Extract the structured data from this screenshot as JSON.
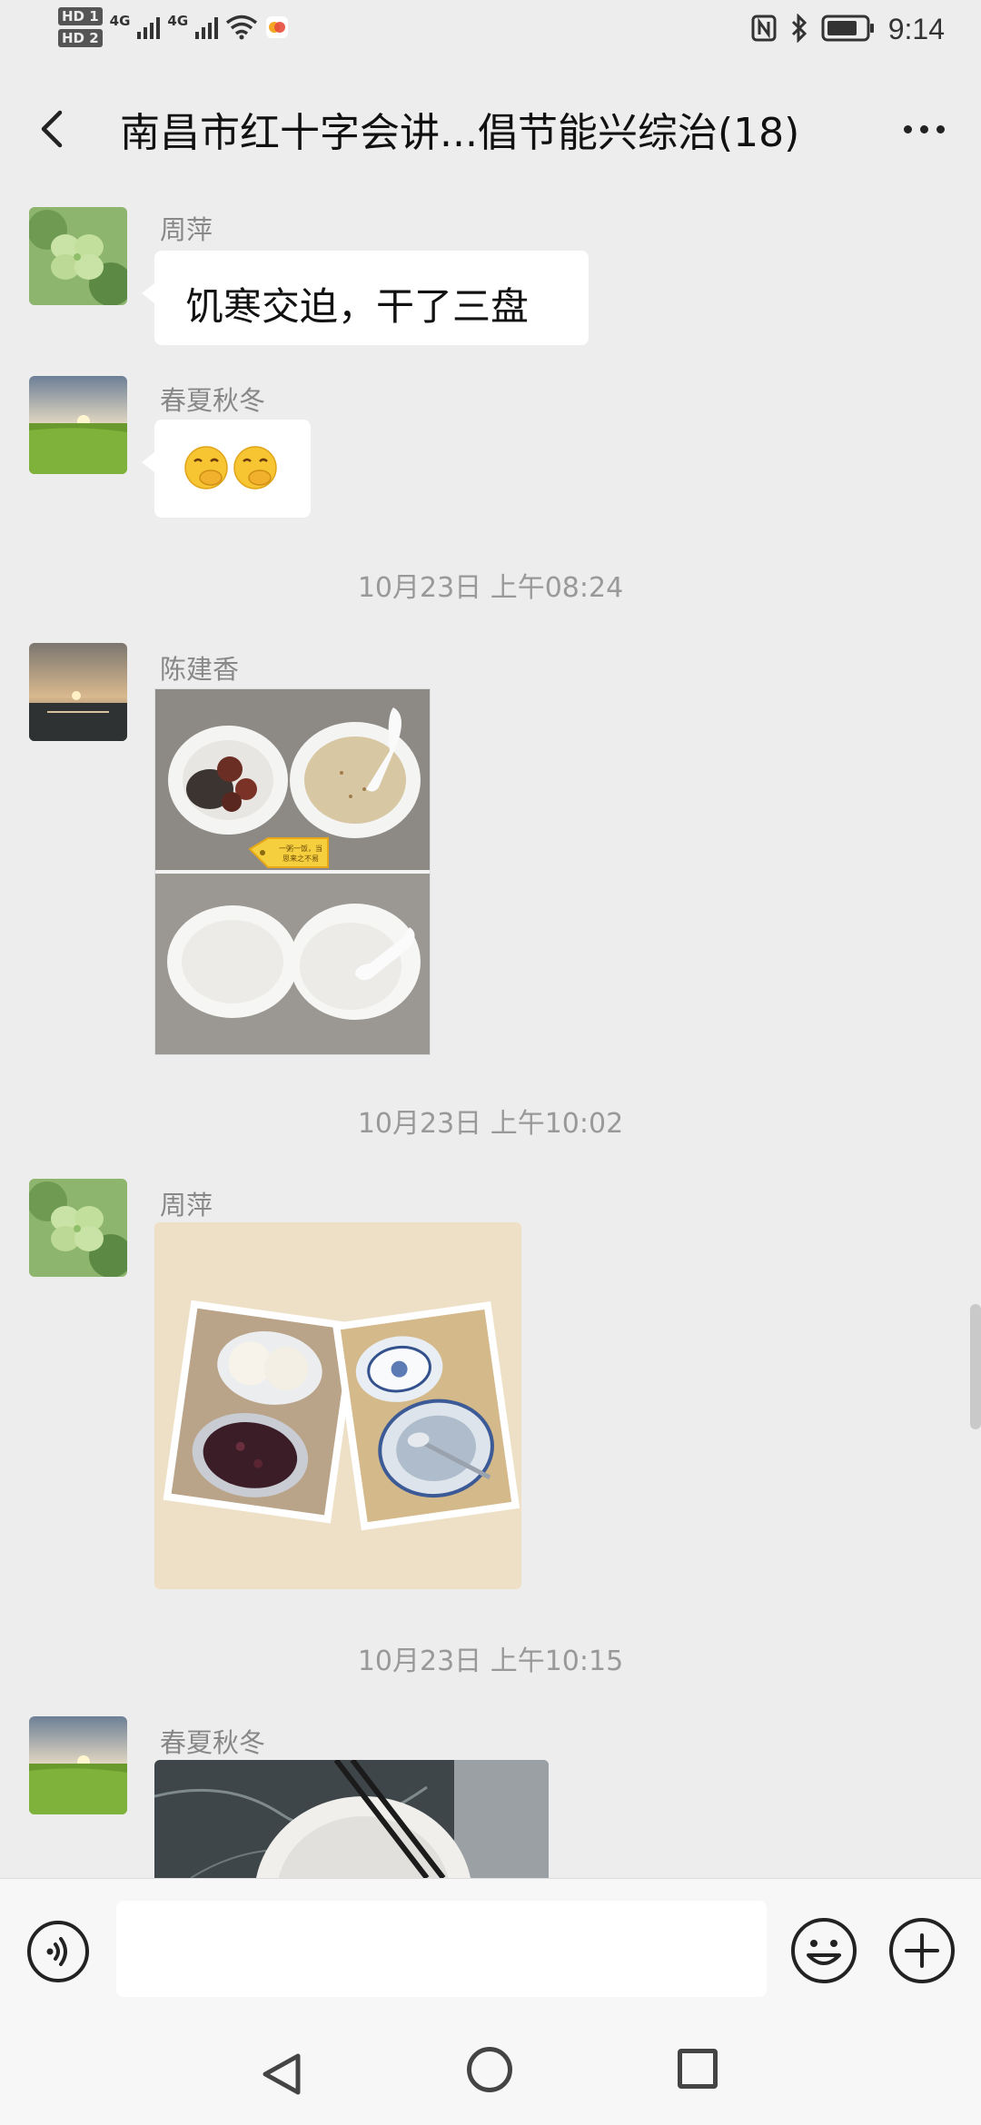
{
  "status_bar": {
    "hd1": "HD 1",
    "hd2": "HD 2",
    "network1": "4G",
    "network2": "4G",
    "time": "9:14",
    "icons": [
      "signal-icon",
      "wifi-icon",
      "app-notification-icon",
      "nfc-icon",
      "bluetooth-icon",
      "battery-icon"
    ]
  },
  "nav": {
    "title": "南昌市红十字会讲...倡节能兴综治(18)",
    "back_icon": "chevron-left-icon",
    "more_icon": "more-icon"
  },
  "messages": [
    {
      "type": "text",
      "sender": "周萍",
      "text": "饥寒交迫，干了三盘",
      "avatar": "clover-avatar"
    },
    {
      "type": "emoji",
      "sender": "春夏秋冬",
      "content": "🤭🤭",
      "avatar": "field-sunset-avatar"
    },
    {
      "type": "time",
      "text": "10月23日 上午08:24"
    },
    {
      "type": "image",
      "sender": "陈建香",
      "avatar": "sea-sunset-avatar",
      "tag_text": [
        "一粥一饭，当",
        "思来之不易"
      ]
    },
    {
      "type": "time",
      "text": "10月23日 上午10:02"
    },
    {
      "type": "image",
      "sender": "周萍",
      "avatar": "clover-avatar"
    },
    {
      "type": "time",
      "text": "10月23日 上午10:15"
    },
    {
      "type": "image",
      "sender": "春夏秋冬",
      "avatar": "field-sunset-avatar"
    }
  ],
  "input_bar": {
    "voice_icon": "voice-icon",
    "input_value": "",
    "emoji_icon": "emoji-icon",
    "plus_icon": "plus-icon"
  },
  "system_nav": {
    "icons": [
      "back-triangle-icon",
      "home-circle-icon",
      "recents-square-icon"
    ]
  }
}
